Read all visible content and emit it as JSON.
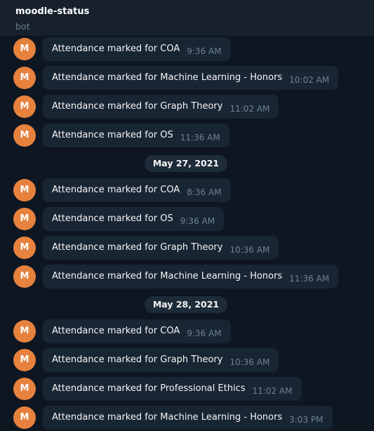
{
  "chat": {
    "title": "moodle-status",
    "subtitle": "bot",
    "avatar_letter": "M"
  },
  "colors": {
    "background": "#0e1621",
    "header": "#17212b",
    "bubble": "#182533",
    "avatar": "#e6823e",
    "time": "#6d8196"
  },
  "messages_group_1": [
    {
      "text": "Attendance marked for COA",
      "time": "9:36 AM"
    },
    {
      "text": "Attendance marked for Machine Learning - Honors",
      "time": "10:02 AM"
    },
    {
      "text": "Attendance marked for Graph Theory",
      "time": "11:02 AM"
    },
    {
      "text": "Attendance marked for OS",
      "time": "11:36 AM"
    }
  ],
  "date_1": "May 27, 2021",
  "messages_group_2": [
    {
      "text": "Attendance marked for COA",
      "time": "8:36 AM"
    },
    {
      "text": "Attendance marked for OS",
      "time": "9:36 AM"
    },
    {
      "text": "Attendance marked for Graph Theory",
      "time": "10:36 AM"
    },
    {
      "text": "Attendance marked for Machine Learning - Honors",
      "time": "11:36 AM"
    }
  ],
  "date_2": "May 28, 2021",
  "messages_group_3": [
    {
      "text": "Attendance marked for COA",
      "time": "9:36 AM"
    },
    {
      "text": "Attendance marked for Graph Theory",
      "time": "10:36 AM"
    },
    {
      "text": "Attendance marked for Professional Ethics",
      "time": "11:02 AM"
    },
    {
      "text": "Attendance marked for Machine Learning - Honors",
      "time": "3:03 PM"
    }
  ]
}
